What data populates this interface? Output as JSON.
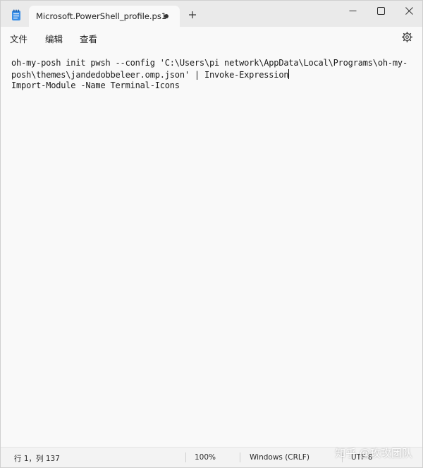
{
  "tab": {
    "title": "Microsoft.PowerShell_profile.ps1"
  },
  "menu": {
    "file": "文件",
    "edit": "编辑",
    "view": "查看"
  },
  "editor": {
    "lines": [
      "oh-my-posh init pwsh --config 'C:\\Users\\pi network\\AppData\\Local\\Programs\\oh-my-",
      "posh\\themes\\jandedobbeleer.omp.json' | Invoke-Expression",
      "Import-Module -Name Terminal-Icons"
    ]
  },
  "status": {
    "position": "行 1，列 137",
    "zoom": "100%",
    "line_ending": "Windows (CRLF)",
    "encoding": "UTF-8"
  },
  "watermark": "知乎 @玫玫团队",
  "icons": {
    "app": "notepad-icon",
    "new_tab": "plus-icon",
    "settings": "gear-icon"
  },
  "colors": {
    "titlebar": "#eaeaea",
    "editor_bg": "#f9f9f9",
    "text": "#1a1a1a"
  }
}
